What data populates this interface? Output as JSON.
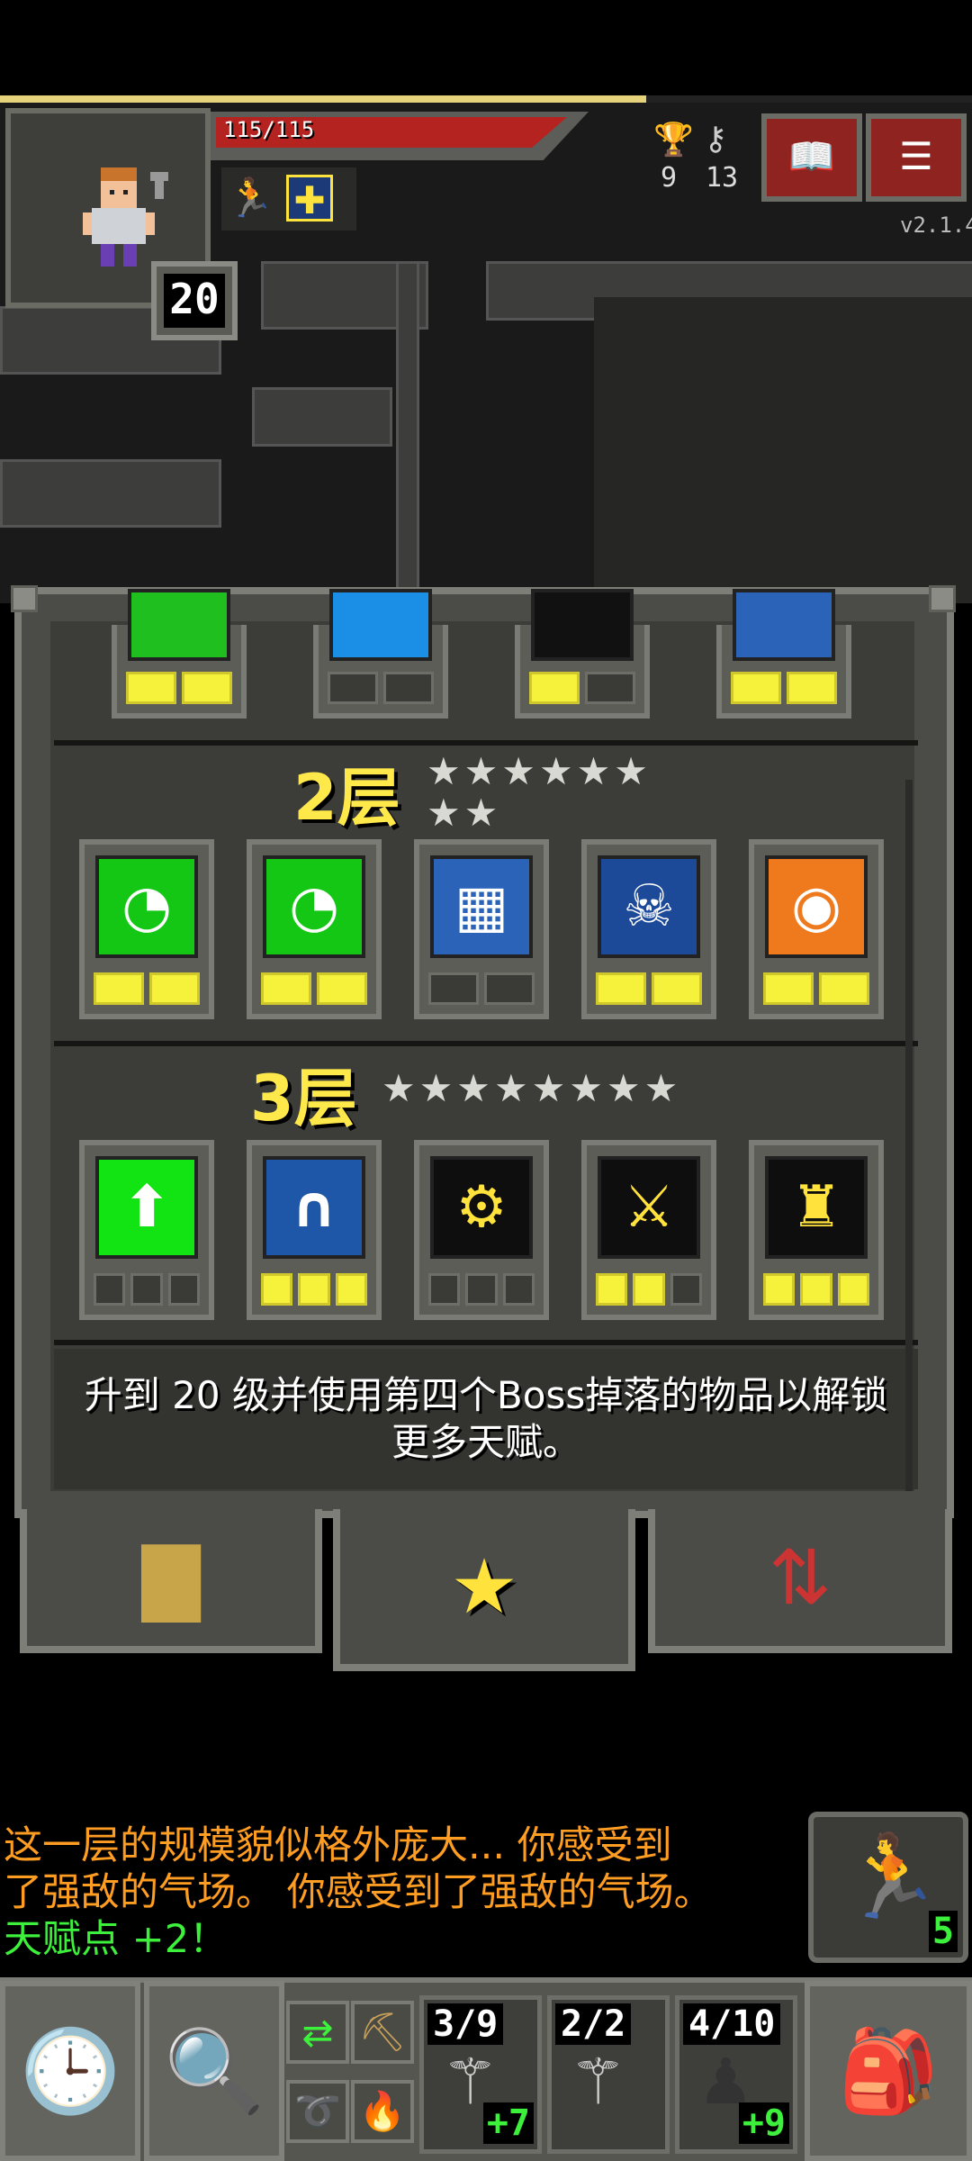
{
  "hud": {
    "hp_text": "115/115",
    "hp_fraction": 1.0,
    "xp_fraction": 0.665,
    "level": "20",
    "depth": "9",
    "iron_keys": "13",
    "version": "v2.1.4",
    "buffs": [
      "haste-icon",
      "bless-icon"
    ],
    "journal_label": "📖",
    "menu_label": "☰"
  },
  "tiers": [
    {
      "title": "",
      "stars": ""
    },
    {
      "title": "2层",
      "stars": "★★★★★★\n★★"
    },
    {
      "title": "3层",
      "stars": "★★★★★★★★"
    }
  ],
  "tier0_talents": [
    {
      "name": "partial-green-talent-icon",
      "color": "#1fbf1f",
      "pips_total": 2,
      "pips_on": 2
    },
    {
      "name": "partial-blue-talent-icon",
      "color": "#1b8fe6",
      "pips_total": 2,
      "pips_on": 0
    },
    {
      "name": "partial-dark-talent-icon",
      "color": "#111111",
      "pips_total": 2,
      "pips_on": 1
    },
    {
      "name": "partial-shield-talent-icon",
      "color": "#2a63b8",
      "pips_total": 2,
      "pips_on": 2
    }
  ],
  "tier2_talents": [
    {
      "name": "food-green-talent-icon",
      "glyph": "◔",
      "color": "#15c715",
      "pips_total": 2,
      "pips_on": 2
    },
    {
      "name": "food-yellow-talent-icon",
      "glyph": "◔",
      "color": "#15c715",
      "pips_total": 2,
      "pips_on": 2
    },
    {
      "name": "grid-talent-icon",
      "glyph": "▦",
      "color": "#2a63b8",
      "pips_total": 2,
      "pips_on": 0
    },
    {
      "name": "sleep-skull-talent-icon",
      "glyph": "☠",
      "color": "#1c4a99",
      "pips_total": 2,
      "pips_on": 2
    },
    {
      "name": "eye-talent-icon",
      "glyph": "◉",
      "color": "#ef7a1d",
      "pips_total": 2,
      "pips_on": 2
    }
  ],
  "tier3_talents": [
    {
      "name": "green-upgrade-talent-icon",
      "glyph": "⬆",
      "color": "#12e312",
      "pips_total": 3,
      "pips_on": 0
    },
    {
      "name": "blue-arch-talent-icon",
      "glyph": "∩",
      "color": "#1f57a8",
      "pips_total": 3,
      "pips_on": 3
    },
    {
      "name": "haste-gear-talent-icon",
      "glyph": "⚙",
      "color": "#0e0e0e",
      "pips_total": 3,
      "pips_on": 0
    },
    {
      "name": "haste-sword-talent-icon",
      "glyph": "⚔",
      "color": "#0e0e0e",
      "pips_total": 3,
      "pips_on": 2
    },
    {
      "name": "haste-armor-talent-icon",
      "glyph": "♜",
      "color": "#0e0e0e",
      "pips_total": 3,
      "pips_on": 3
    }
  ],
  "unlock_message": "升到 20 级并使用第四个Boss掉落的物品以解锁更多天赋。",
  "tabs": [
    {
      "icon": "stats-icon",
      "glyph": "▇"
    },
    {
      "icon": "star-icon",
      "glyph": "★"
    },
    {
      "icon": "swap-icon",
      "glyph": "⇅"
    }
  ],
  "log": [
    {
      "text": "这一层的规模貌似格外庞大... 你感受到",
      "color": "orange"
    },
    {
      "text": "了强敌的气场。 你感受到了强敌的气场。",
      "color": "orange"
    },
    {
      "text": "天赋点 +2！",
      "color": "green"
    }
  ],
  "quickslot_main": {
    "icon": "haste-icon",
    "count": "5"
  },
  "toolbar": {
    "wait_icon": "clock-icon",
    "search_icon": "magnifier-icon",
    "quickslots": [
      {
        "top": "3/9",
        "bottom": "+7",
        "icon": "wand-icon"
      },
      {
        "top": "2/2",
        "bottom": "",
        "icon": "wand-icon"
      },
      {
        "top": "4/10",
        "bottom": "+9",
        "icon": "cloak-icon"
      }
    ],
    "backpack_icon": "backpack-icon"
  }
}
